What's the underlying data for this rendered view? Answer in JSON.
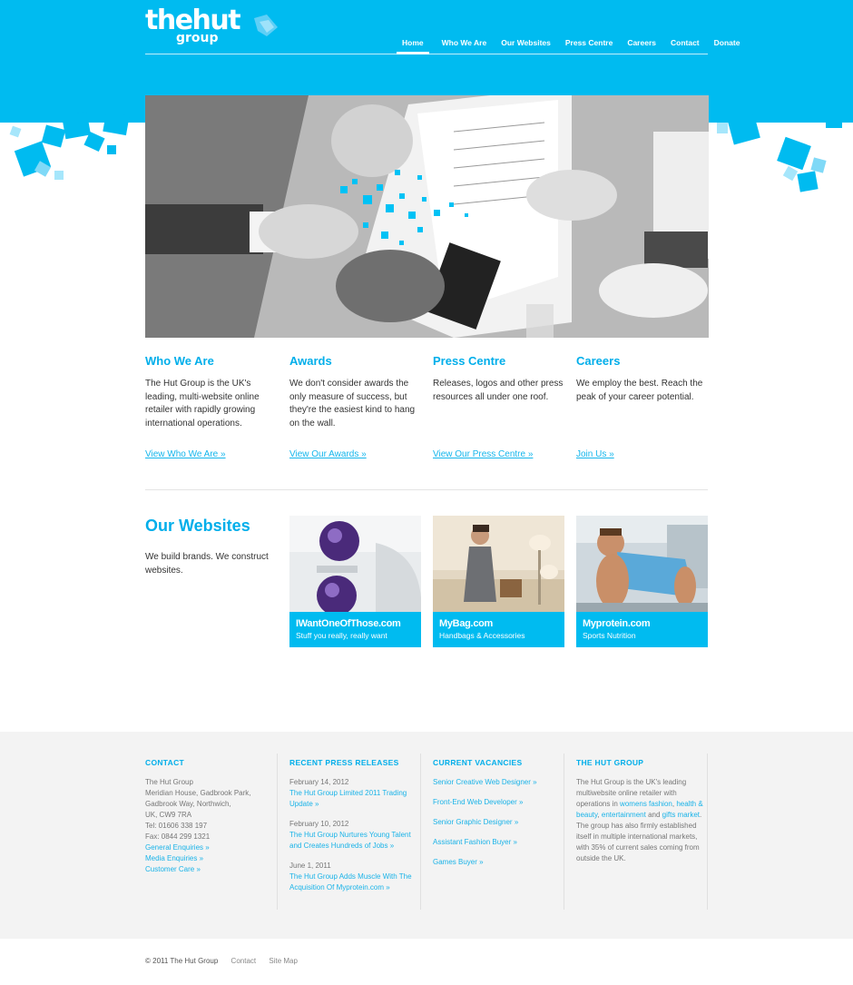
{
  "brand": {
    "logo_word1": "thehut",
    "logo_word2": "group",
    "accent": "#00bbf0"
  },
  "nav": {
    "items": [
      {
        "label": "Home",
        "active": true
      },
      {
        "label": "Who We Are"
      },
      {
        "label": "Our Websites"
      },
      {
        "label": "Press Centre"
      },
      {
        "label": "Careers"
      },
      {
        "label": "Contact"
      },
      {
        "label": "Donate"
      }
    ]
  },
  "hero": {
    "image": "business-meeting-photo"
  },
  "features": [
    {
      "title": "Who We Are",
      "text": "The Hut Group is the UK's leading, multi-website online retailer with rapidly growing international operations.",
      "link": "View Who We Are »"
    },
    {
      "title": "Awards",
      "text": "We don't consider awards the only measure of success, but they're the easiest kind to hang on the wall.",
      "link": "View Our Awards »"
    },
    {
      "title": "Press Centre",
      "text": "Releases, logos and other press resources all under one roof.",
      "link": "View Our Press Centre »"
    },
    {
      "title": "Careers",
      "text": "We employ the best. Reach the peak of your career potential.",
      "link": "Join Us »"
    }
  ],
  "websites": {
    "title": "Our Websites",
    "description": "We build brands. We construct websites.",
    "items": [
      {
        "name": "IWantOneOfThose.com",
        "tagline": "Stuff you really, really want"
      },
      {
        "name": "MyBag.com",
        "tagline": "Handbags & Accessories"
      },
      {
        "name": "Myprotein.com",
        "tagline": "Sports Nutrition"
      }
    ]
  },
  "footer": {
    "contact": {
      "heading": "CONTACT",
      "lines": [
        "The Hut Group",
        "Meridian House, Gadbrook Park,",
        "Gadbrook Way, Northwich,",
        "UK, CW9 7RA",
        "Tel: 01606 338 197",
        "Fax: 0844 299 1321"
      ],
      "links": [
        "General Enquiries »",
        "Media Enquiries »",
        "Customer Care »"
      ]
    },
    "press": {
      "heading": "RECENT PRESS RELEASES",
      "items": [
        {
          "date": "February 14, 2012",
          "title": "The Hut Group Limited 2011 Trading Update »"
        },
        {
          "date": "February 10, 2012",
          "title": "The Hut Group Nurtures Young Talent and Creates Hundreds of Jobs »"
        },
        {
          "date": "June 1, 2011",
          "title": "The Hut Group Adds Muscle With The Acquisition Of Myprotein.com »"
        }
      ]
    },
    "vacancies": {
      "heading": "CURRENT VACANCIES",
      "items": [
        "Senior Creative Web Designer »",
        "Front-End Web Developer »",
        "Senior Graphic Designer »",
        "Assistant Fashion Buyer »",
        "Games Buyer »"
      ]
    },
    "about": {
      "heading": "THE HUT GROUP",
      "text1": "The Hut Group is the UK's leading multiwebsite online retailer with operations in",
      "link1": "womens fashion",
      "sep1": ",",
      "link2": "health & beauty",
      "sep2": ",",
      "link3": "entertainment",
      "text2": "and",
      "link4": "gifts market",
      "text3": ". The group has also firmly established itself in multiple international markets, with 35% of current sales coming from outside the UK."
    }
  },
  "bottom": {
    "copyright": "© 2011 The Hut Group",
    "links": [
      "Contact",
      "Site Map"
    ]
  }
}
